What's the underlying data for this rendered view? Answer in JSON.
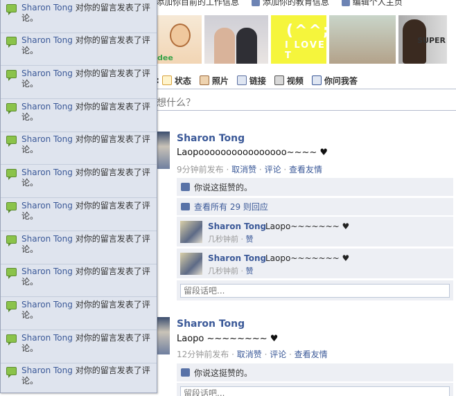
{
  "header": {
    "links": [
      "添加你目前的工作信息",
      "添加你的教育信息",
      "编辑个人主页"
    ]
  },
  "photos": {
    "p1_text": "dee",
    "p3_text": "(^^;",
    "p3_subtext": "I LOVE T",
    "p5_text": "SUPER"
  },
  "composer": {
    "lead": ":",
    "tabs": [
      "状态",
      "照片",
      "链接",
      "视频",
      "你问我答"
    ],
    "placeholder": "想什么？"
  },
  "posts": [
    {
      "author": "Sharon Tong",
      "message": "Laopoooooooooooooooo~~~~ ♥",
      "time": "9分钟前发布",
      "actions": [
        "取消赞",
        "评论",
        "查看友情"
      ],
      "like_text": "你说这挺赞的。",
      "view_all": "查看所有 29 则回应",
      "comments": [
        {
          "author": "Sharon Tong",
          "text": "Laopo~~~~~~~ ♥",
          "time": "几秒钟前",
          "action": "赞"
        },
        {
          "author": "Sharon Tong",
          "text": "Laopo~~~~~~~ ♥",
          "time": "几秒钟前",
          "action": "赞"
        }
      ],
      "reply_placeholder": "留段话吧..."
    },
    {
      "author": "Sharon Tong",
      "message": "Laopo ~~~~~~~~ ♥",
      "time": "12分钟前发布",
      "actions": [
        "取消赞",
        "评论",
        "查看友情"
      ],
      "like_text": "你说这挺赞的。",
      "reply_placeholder": "留段话吧..."
    }
  ],
  "notifications": [
    {
      "who": "Sharon Tong",
      "text": " 对你的留言发表了评论。"
    },
    {
      "who": "Sharon Tong",
      "text": " 对你的留言发表了评论。"
    },
    {
      "who": "Sharon Tong",
      "text": " 对你的留言发表了评论。"
    },
    {
      "who": "Sharon Tong",
      "text": " 对你的留言发表了评论。"
    },
    {
      "who": "Sharon Tong",
      "text": " 对你的留言发表了评论。"
    },
    {
      "who": "Sharon Tong",
      "text": " 对你的留言发表了评论。"
    },
    {
      "who": "Sharon Tong",
      "text": " 对你的留言发表了评论。"
    },
    {
      "who": "Sharon Tong",
      "text": " 对你的留言发表了评论。"
    },
    {
      "who": "Sharon Tong",
      "text": " 对你的留言发表了评论。"
    },
    {
      "who": "Sharon Tong",
      "text": " 对你的留言发表了评论。"
    },
    {
      "who": "Sharon Tong",
      "text": " 对你的留言发表了评论。"
    },
    {
      "who": "Sharon Tong",
      "text": " 对你的留言发表了评论。"
    }
  ],
  "colors": {
    "link_blue": "#3b5998",
    "panel_bg": "#dfe4ee",
    "like_bar_bg": "#edeff4",
    "notif_icon_green": "#8bc34a"
  }
}
